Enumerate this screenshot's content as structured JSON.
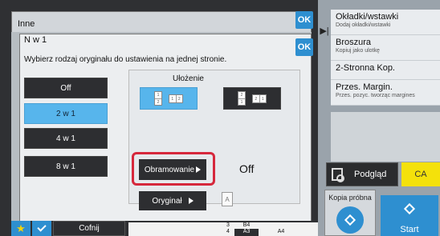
{
  "window": {
    "title": "Inne",
    "ok_label": "OK"
  },
  "right_panel": {
    "items": [
      {
        "title": "Okładki/wstawki",
        "subtitle": "Dodaj okładki/wstawki"
      },
      {
        "title": "Broszura",
        "subtitle": "Kopiuj jako ulotkę"
      },
      {
        "title": "2-Stronna Kop.",
        "subtitle": ""
      },
      {
        "title": "Przes. Margin.",
        "subtitle": "Przes. pozyc. tworząc margines"
      }
    ],
    "preview_label": "Podgląd",
    "ca_label": "CA",
    "kopia_label": "Kopia próbna",
    "start_label": "Start"
  },
  "dialog": {
    "title": "N w 1",
    "ok_label": "OK",
    "instruction": "Wybierz rodzaj oryginału do ustawienia na jednej stronie.",
    "modes": [
      "Off",
      "2 w 1",
      "4 w 1",
      "8 w 1"
    ],
    "selected_mode": "2 w 1",
    "layout_label": "Ułożenie",
    "layout_options": [
      {
        "icon": "page-order-1-2-icon",
        "page_a": "1",
        "page_b": "2",
        "selected": true
      },
      {
        "icon": "page-order-2-1-icon",
        "page_a": "2",
        "page_b": "1",
        "selected": false
      }
    ],
    "border_button_label": "Obramowanie",
    "border_value": "Off",
    "original_button_label": "Oryginał",
    "original_icon_label": "A"
  },
  "bottom_bar": {
    "back_label": "Cofnij",
    "tray": {
      "row1_num": "3",
      "row1_size": "B4",
      "row2_num": "4",
      "row2_size": "A3",
      "paper_size": "A4"
    }
  },
  "colors": {
    "accent": "#2e8fd0",
    "selected": "#57b5ec",
    "highlight_frame": "#d6283c",
    "ca": "#f4e10b"
  }
}
